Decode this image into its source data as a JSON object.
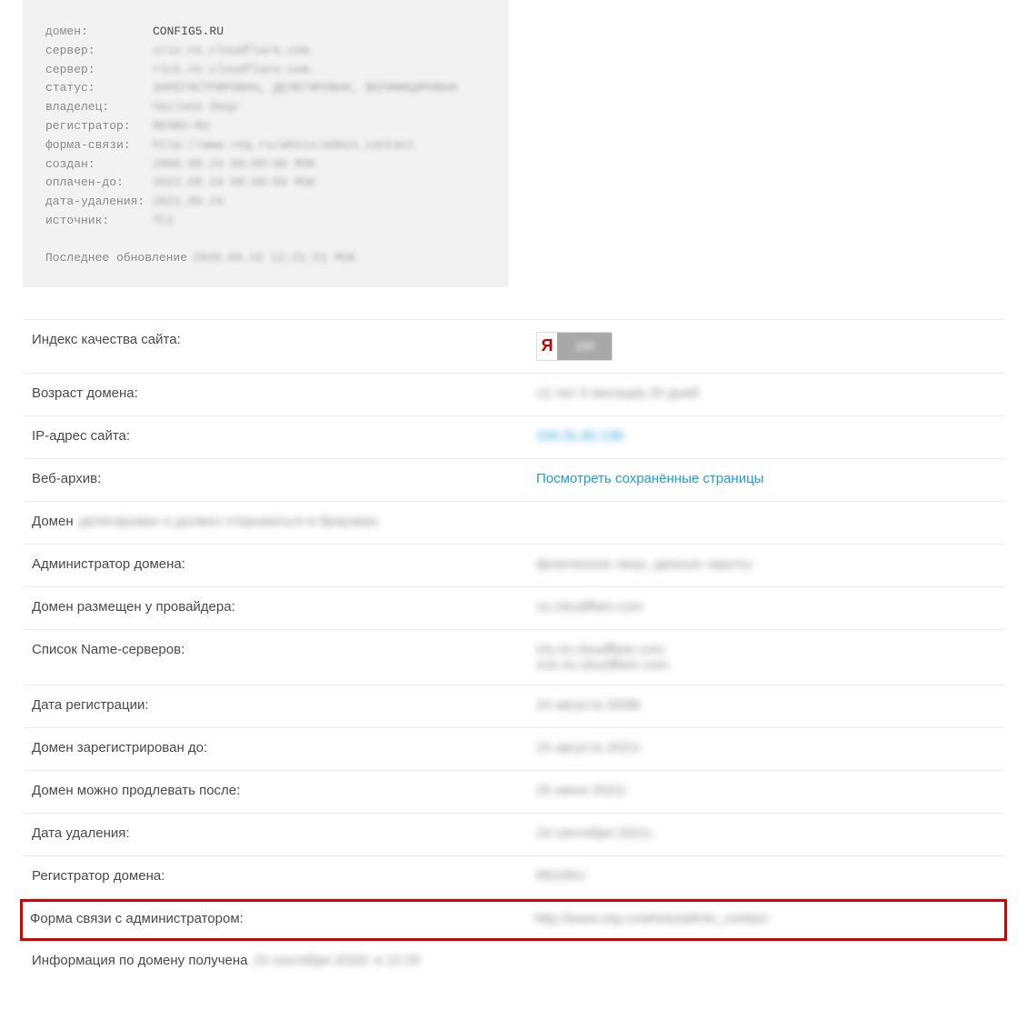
{
  "whois": {
    "rows": [
      {
        "label": "домен:",
        "value": "CONFIG5.RU",
        "clear": true
      },
      {
        "label": "сервер:",
        "value": "iris.ns.cloudflare.com."
      },
      {
        "label": "сервер:",
        "value": "rick.ns.cloudflare.com."
      },
      {
        "label": "статус:",
        "value": "ЗАРЕГИСТРИРОВАН, ДЕЛЕГИРОВАН, ВЕРИФИЦИРОВАН"
      },
      {
        "label": "владелец:",
        "value": "Частное Лицо"
      },
      {
        "label": "регистратор:",
        "value": "REGRU-RU"
      },
      {
        "label": "форма-связи:",
        "value": "http://www.reg.ru/whois/admin_contact"
      },
      {
        "label": "создан:",
        "value": "2008.08.24 00:00:00 MSK"
      },
      {
        "label": "оплачен-до:",
        "value": "2021.08.24 00:00:00 MSK"
      },
      {
        "label": "дата-удаления:",
        "value": "2021.09.24"
      },
      {
        "label": "источник:",
        "value": "TCI"
      }
    ],
    "footer_label": "Последнее обновление",
    "footer_value": "2020.09.15 12:21:51 MSK"
  },
  "info": {
    "quality_label": "Индекс качества сайта:",
    "ya_letter": "Я",
    "ya_value": "100",
    "age_label": "Возраст домена:",
    "age_value": "12 лет 0 месяцев 25 дней",
    "ip_label": "IP-адрес сайта:",
    "ip_value": "104.31.82.136",
    "archive_label": "Веб-архив:",
    "archive_link": "Посмотреть сохранённые страницы",
    "domain_status_label": "Домен",
    "domain_status_value": "делегирован и должен открываться в браузере.",
    "admin_label": "Администратор домена:",
    "admin_value": "физическое лицо, данные скрыты",
    "provider_label": "Домен размещен у провайдера:",
    "provider_value": "ns.cloudflare.com",
    "ns_label": "Список Name-серверов:",
    "ns_value_1": "iris.ns.cloudflare.com.",
    "ns_value_2": "rick.ns.cloudflare.com.",
    "reg_date_label": "Дата регистрации:",
    "reg_date_value": "24 августа 2008г.",
    "reg_until_label": "Домен зарегистрирован до:",
    "reg_until_value": "24 августа 2021г.",
    "renew_after_label": "Домен можно продлевать после:",
    "renew_after_value": "25 июня 2021г.",
    "delete_date_label": "Дата удаления:",
    "delete_date_value": "24 сентября 2021г.",
    "registrar_label": "Регистратор домена:",
    "registrar_value": "REGRU",
    "contact_form_label": "Форма связи с администратором:",
    "contact_form_value": "http://www.reg.ru/whois/admin_contact",
    "received_label": "Информация по домену получена",
    "received_value": "15 сентября 2020г. в 12:25"
  }
}
